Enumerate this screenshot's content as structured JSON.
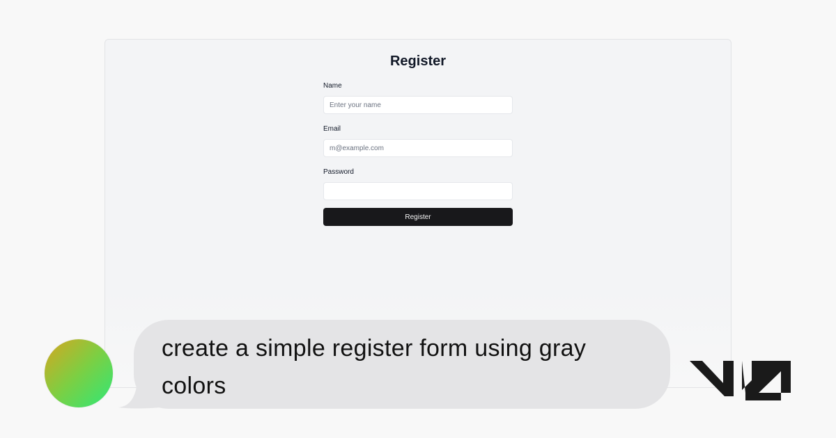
{
  "preview": {
    "title": "Register",
    "fields": [
      {
        "label": "Name",
        "placeholder": "Enter your name",
        "value": ""
      },
      {
        "label": "Email",
        "placeholder": "m@example.com",
        "value": ""
      },
      {
        "label": "Password",
        "placeholder": "",
        "value": ""
      }
    ],
    "submit_label": "Register"
  },
  "chat": {
    "prompt": "create a simple register form using gray colors"
  },
  "icons": {
    "avatar": "user-avatar",
    "logo": "v0-logo-icon"
  },
  "colors": {
    "page_background": "#f8f8f8",
    "preview_background": "#f3f4f6",
    "button_background": "#18181b",
    "bubble_background": "#e4e4e6",
    "avatar_gradient_start": "#d6a620",
    "avatar_gradient_end": "#2ee878"
  }
}
